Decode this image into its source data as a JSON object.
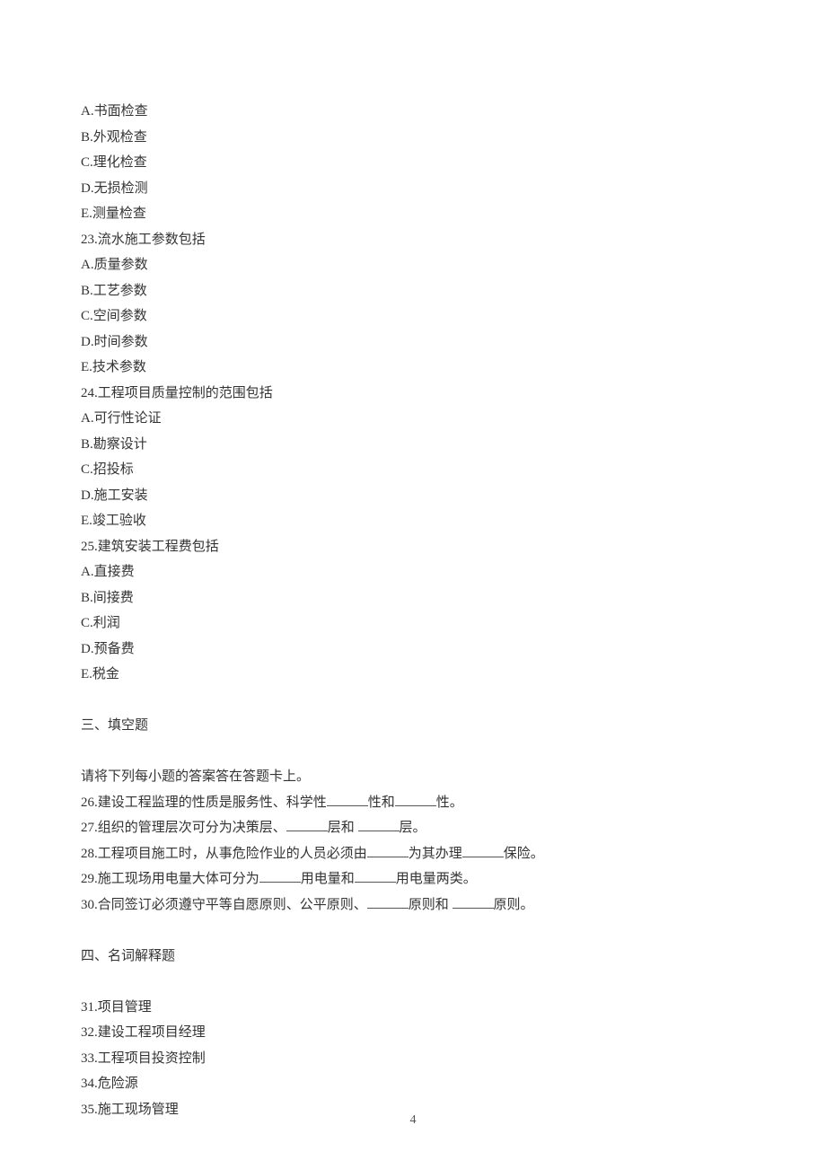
{
  "q22_options": {
    "A": "A.书面检查",
    "B": "B.外观检查",
    "C": "C.理化检查",
    "D": "D.无损检测",
    "E": "E.测量检查"
  },
  "q23": {
    "stem": "23.流水施工参数包括",
    "A": "A.质量参数",
    "B": "B.工艺参数",
    "C": "C.空间参数",
    "D": "D.时间参数",
    "E": "E.技术参数"
  },
  "q24": {
    "stem": "24.工程项目质量控制的范围包括",
    "A": "A.可行性论证",
    "B": "B.勘察设计",
    "C": "C.招投标",
    "D": "D.施工安装",
    "E": "E.竣工验收"
  },
  "q25": {
    "stem": "25.建筑安装工程费包括",
    "A": "A.直接费",
    "B": "B.间接费",
    "C": "C.利润",
    "D": "D.预备费",
    "E": "E.税金"
  },
  "section3": {
    "title": "三、填空题",
    "instruction": "请将下列每小题的答案答在答题卡上。"
  },
  "q26": {
    "p1": "26.建设工程监理的性质是服务性、科学性",
    "p2": "性和",
    "p3": "性。"
  },
  "q27": {
    "p1": "27.组织的管理层次可分为决策层、",
    "p2": "层和 ",
    "p3": "层。"
  },
  "q28": {
    "p1": "28.工程项目施工时，从事危险作业的人员必须由",
    "p2": "为其办理",
    "p3": "保险。"
  },
  "q29": {
    "p1": "29.施工现场用电量大体可分为",
    "p2": "用电量和",
    "p3": "用电量两类。"
  },
  "q30": {
    "p1": "30.合同签订必须遵守平等自愿原则、公平原则、",
    "p2": "原则和 ",
    "p3": "原则。"
  },
  "section4": {
    "title": "四、名词解释题"
  },
  "q31": "31.项目管理",
  "q32": "32.建设工程项目经理",
  "q33": "33.工程项目投资控制",
  "q34": "34.危险源",
  "q35": "35.施工现场管理",
  "pageNumber": "4"
}
